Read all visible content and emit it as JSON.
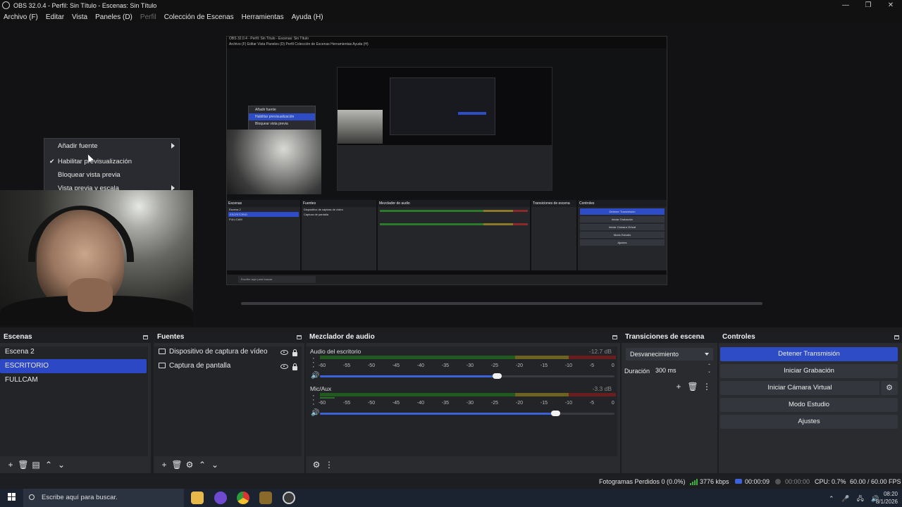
{
  "window": {
    "title": "OBS 32.0.4 - Perfil: Sin Título - Escenas: Sin Título",
    "controls": [
      "—",
      "❐",
      "✕"
    ]
  },
  "menu": {
    "items": [
      "Archivo (F)",
      "Editar",
      "Vista",
      "Paneles (D)",
      "Perfil",
      "Colección de Escenas",
      "Herramientas",
      "Ayuda (H)"
    ]
  },
  "nested_preview": {
    "title": "OBS 32.0.4 - Perfil: Sin Título - Escenas: Sin Título",
    "menu": "Archivo (F)   Editar   Vista   Paneles (D)   Perfil   Colección de Escenas   Herramientas   Ayuda (H)",
    "context_items": [
      "Añadir fuente",
      "Habilitar previsualización",
      "Bloquear vista previa"
    ],
    "docks": [
      "Escenas",
      "Fuentes",
      "Mezclador de audio",
      "Transiciones de escena",
      "Controles"
    ],
    "scenes": [
      "Escena 2",
      "ESCRITORIO",
      "FULLCAM"
    ],
    "sources": [
      "Dispositivo de captura de vídeo",
      "Captura de pantalla"
    ],
    "controls": [
      "Detener Transmisión",
      "Iniciar Grabación",
      "Iniciar Cámara Virtual",
      "Modo Estudio",
      "Ajustes"
    ],
    "search": "Escribe aquí para buscar."
  },
  "context_menu": {
    "items": [
      {
        "label": "Añadir fuente",
        "submenu": true,
        "checked": false
      },
      {
        "label": "Habilitar previsualización",
        "submenu": false,
        "checked": true
      },
      {
        "label": "Bloquear vista previa",
        "submenu": false,
        "checked": false
      },
      {
        "label": "Vista previa y escala",
        "submenu": true,
        "checked": false
      }
    ]
  },
  "docks": {
    "scenes": {
      "title": "Escenas",
      "items": [
        "Escena 2",
        "ESCRITORIO",
        "FULLCAM"
      ],
      "selected": 1
    },
    "sources": {
      "title": "Fuentes",
      "items": [
        {
          "label": "Dispositivo de captura de vídeo",
          "icon": "camera-icon"
        },
        {
          "label": "Captura de pantalla",
          "icon": "monitor-icon"
        }
      ]
    },
    "mixer": {
      "title": "Mezclador de audio",
      "ticks": [
        "-60",
        "-55",
        "-50",
        "-45",
        "-40",
        "-35",
        "-30",
        "-25",
        "-20",
        "-15",
        "-10",
        "-5",
        "0"
      ],
      "channels": [
        {
          "name": "Audio del escritorio",
          "db": "-12.7 dB",
          "volume": 0.6
        },
        {
          "name": "Mic/Aux",
          "db": "-3.3 dB",
          "volume": 0.8
        }
      ]
    },
    "transitions": {
      "title": "Transiciones de escena",
      "selected": "Desvanecimiento",
      "duration_label": "Duración",
      "duration_value": "300 ms"
    },
    "controls": {
      "title": "Controles",
      "buttons": [
        "Detener Transmisión",
        "Iniciar Grabación",
        "Iniciar Cámara Virtual",
        "Modo Estudio",
        "Ajustes"
      ]
    }
  },
  "status": {
    "dropped": "Fotogramas Perdidos 0 (0.0%)",
    "bitrate": "3776 kbps",
    "stream_time": "00:00:09",
    "rec_time": "00:00:00",
    "cpu": "CPU: 0.7%",
    "fps": "60.00 / 60.00 FPS"
  },
  "taskbar": {
    "search_placeholder": "Escribe aquí para buscar.",
    "time": "08:20",
    "date": "8/1/2026"
  },
  "colors": {
    "accent": "#2d4cc6",
    "dock_bg": "#2a2b2f",
    "meter_green": "#215a1f",
    "meter_yellow": "#6d6321",
    "meter_red": "#6a1d1f"
  }
}
